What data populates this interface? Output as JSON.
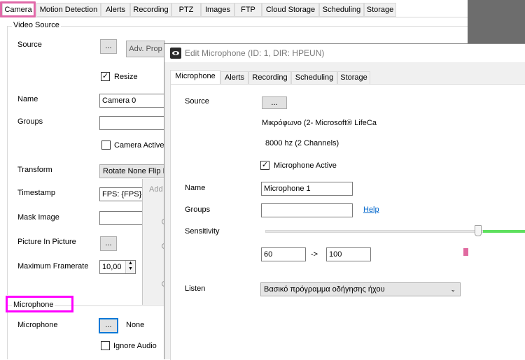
{
  "camera_tabs": [
    {
      "label": "Camera"
    },
    {
      "label": "Motion Detection"
    },
    {
      "label": "Alerts"
    },
    {
      "label": "Recording"
    },
    {
      "label": "PTZ"
    },
    {
      "label": "Images"
    },
    {
      "label": "FTP"
    },
    {
      "label": "Cloud Storage"
    },
    {
      "label": "Scheduling"
    },
    {
      "label": "Storage"
    }
  ],
  "video_source": {
    "title": "Video Source",
    "source_label": "Source",
    "source_button": "...",
    "adv_button": "Adv. Prop",
    "resize_label": "Resize",
    "resize_checked": "✓",
    "name_label": "Name",
    "name_value": "Camera 0",
    "groups_label": "Groups",
    "groups_value": "",
    "camera_active_label": "Camera Active",
    "transform_label": "Transform",
    "transform_value": "Rotate None Flip N",
    "timestamp_label": "Timestamp",
    "timestamp_value": "FPS: {FPS}",
    "mask_label": "Mask Image",
    "pip_label": "Picture In Picture",
    "pip_button": "...",
    "framerate_label": "Maximum Framerate",
    "framerate_value": "10,00"
  },
  "microphone_section": {
    "title": "Microphone",
    "mic_label": "Microphone",
    "mic_button": "...",
    "mic_value": "None",
    "ignore_audio_label": "Ignore Audio"
  },
  "add_dialog": {
    "title": "Add"
  },
  "edit_window": {
    "title": "Edit Microphone (ID: 1, DIR: HPEUN)",
    "tabs": [
      {
        "label": "Microphone"
      },
      {
        "label": "Alerts"
      },
      {
        "label": "Recording"
      },
      {
        "label": "Scheduling"
      },
      {
        "label": "Storage"
      }
    ],
    "source_label": "Source",
    "source_button": "...",
    "device_name": "Μικρόφωνο (2- Microsoft® LifeCa",
    "device_format": "8000 hz (2 Channels)",
    "mic_active_label": "Microphone Active",
    "mic_active_checked": "✓",
    "name_label": "Name",
    "name_value": "Microphone 1",
    "groups_label": "Groups",
    "groups_value": "",
    "help_link": "Help",
    "sensitivity_label": "Sensitivity",
    "sensitivity_min": "60",
    "sensitivity_arrow": "->",
    "sensitivity_max": "100",
    "listen_label": "Listen",
    "listen_value": "Βασικό πρόγραμμα οδήγησης ήχου"
  },
  "colors": {
    "camera_tab_highlight": "#e069a8",
    "microphone_highlight": "#ff00ff",
    "sensitivity_level": "#5ee05e",
    "level_marker": "#e06aa0"
  }
}
